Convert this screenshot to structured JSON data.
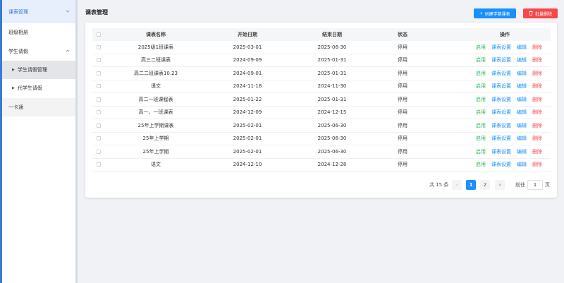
{
  "sidebar": {
    "items": [
      {
        "label": "课表管理"
      },
      {
        "label": "班级相册"
      },
      {
        "label": "学生请假"
      },
      {
        "label": "学生请假管理"
      },
      {
        "label": "代学生请假"
      },
      {
        "label": "一卡通"
      }
    ]
  },
  "header": {
    "title": "课表管理",
    "create_label": "创建学期课表",
    "batch_delete_label": "批量删除"
  },
  "table": {
    "headers": {
      "name": "课表名称",
      "start": "开始日期",
      "end": "结束日期",
      "status": "状态",
      "ops": "操作"
    },
    "rows": [
      {
        "name": "2025级1班课表",
        "start": "2025-03-01",
        "end": "2025-06-30",
        "status": "停用"
      },
      {
        "name": "高三二班课表",
        "start": "2024-09-09",
        "end": "2025-01-31",
        "status": "停用"
      },
      {
        "name": "高二二班课表10.23",
        "start": "2024-09-01",
        "end": "2025-01-31",
        "status": "停用"
      },
      {
        "name": "语文",
        "start": "2024-11-18",
        "end": "2024-11-30",
        "status": "停用"
      },
      {
        "name": "高二一班课程表",
        "start": "2025-01-22",
        "end": "2025-01-31",
        "status": "停用"
      },
      {
        "name": "高一、一班课表",
        "start": "2024-12-09",
        "end": "2024-12-15",
        "status": "停用"
      },
      {
        "name": "25年上学期课表",
        "start": "2025-02-01",
        "end": "2025-06-30",
        "status": "停用"
      },
      {
        "name": "25年上学期",
        "start": "2025-02-01",
        "end": "2025-06-30",
        "status": "停用"
      },
      {
        "name": "25年上学期",
        "start": "2025-02-01",
        "end": "2025-06-30",
        "status": "停用"
      },
      {
        "name": "语文",
        "start": "2024-12-10",
        "end": "2024-12-28",
        "status": "停用"
      }
    ],
    "ops": {
      "enable": "启用",
      "settings": "课表设置",
      "edit": "编辑",
      "delete": "删除"
    }
  },
  "pagination": {
    "total_text": "共 15 条",
    "pages": [
      "1",
      "2"
    ],
    "current": "1",
    "goto_label": "前往",
    "goto_value": "1",
    "page_suffix": "页"
  },
  "colors": {
    "primary": "#1890ff",
    "danger": "#f5484b",
    "success": "#30b45f"
  },
  "icons": {
    "create": "plus-icon",
    "batch_delete": "trash-icon",
    "expand": "chevron-down-icon",
    "collapse": "chevron-up-icon",
    "prev": "chevron-left-icon",
    "next": "chevron-right-icon"
  }
}
